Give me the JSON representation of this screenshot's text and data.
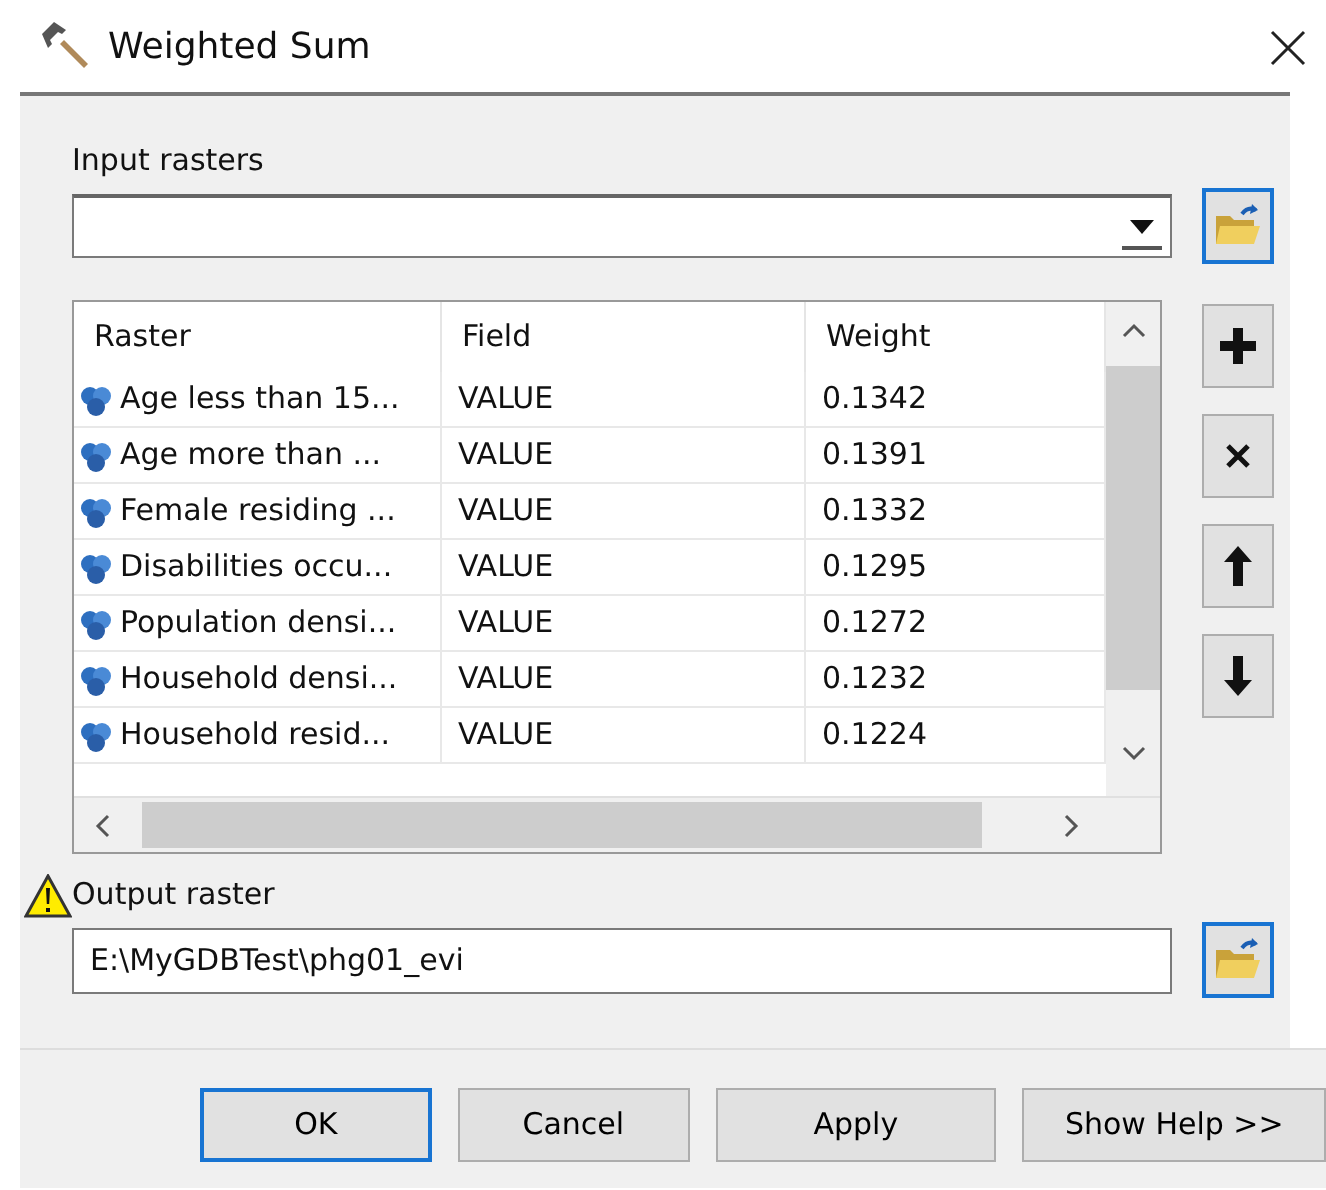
{
  "window": {
    "title": "Weighted Sum"
  },
  "input_rasters": {
    "label": "Input rasters"
  },
  "table": {
    "columns": [
      "Raster",
      "Field",
      "Weight"
    ],
    "rows": [
      {
        "raster": "Age less than 15...",
        "field": "VALUE",
        "weight": "0.1342"
      },
      {
        "raster": "Age more than ...",
        "field": "VALUE",
        "weight": "0.1391"
      },
      {
        "raster": "Female residing ...",
        "field": "VALUE",
        "weight": "0.1332"
      },
      {
        "raster": "Disabilities occu...",
        "field": "VALUE",
        "weight": "0.1295"
      },
      {
        "raster": "Population densi...",
        "field": "VALUE",
        "weight": "0.1272"
      },
      {
        "raster": "Household densi...",
        "field": "VALUE",
        "weight": "0.1232"
      },
      {
        "raster": "Household resid...",
        "field": "VALUE",
        "weight": "0.1224"
      }
    ]
  },
  "output_raster": {
    "label": "Output raster",
    "value": "E:\\MyGDBTest\\phg01_evi",
    "warning": true
  },
  "buttons": [
    {
      "label": "OK",
      "default": true
    },
    {
      "label": "Cancel",
      "default": false
    },
    {
      "label": "Apply",
      "default": false
    },
    {
      "label": "Show Help >>",
      "default": false
    }
  ]
}
